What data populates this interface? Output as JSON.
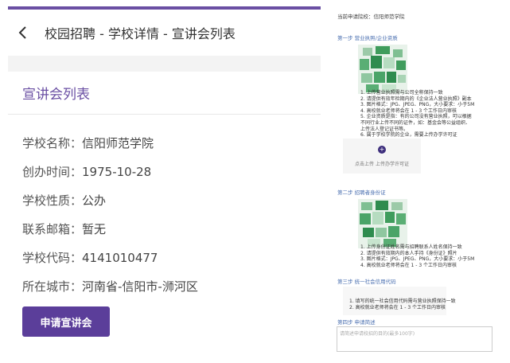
{
  "header": {
    "title": "校园招聘 - 学校详情 - 宣讲会列表"
  },
  "section": {
    "title": "宣讲会列表"
  },
  "school": {
    "fields": [
      {
        "label": "学校名称：",
        "value": "信阳师范学院"
      },
      {
        "label": "创办时间：",
        "value": "1975-10-28"
      },
      {
        "label": "学校性质：",
        "value": "公办"
      },
      {
        "label": "联系邮箱：",
        "value": "暂无"
      },
      {
        "label": "学校代码：",
        "value": "4141010477"
      },
      {
        "label": "所在城市：",
        "value": "河南省-信阳市-浉河区"
      }
    ],
    "apply_label": "申请宣讲会"
  },
  "form": {
    "target_label": "当前申请院校：",
    "target_value": "信阳师范学院",
    "step1": {
      "title": "第一步 营业执照/企业资质",
      "items": [
        "1. 上传营业执照需与公司全称保持一致",
        "2. 请提供有效年检期内的《企业法人营业执照》副本",
        "3. 图片格式：JPG、JPEG、PNG，大小要求：小于5M",
        "4. 高校就业老师将会在 1 - 3 个工作日内审核",
        "5. 企业资质是指：有的公司没有营业执照，可以根据",
        "   不同行业上传不同的证件，如：基金会等公益组织、",
        "   上传法人登记证书等。",
        "6. 属于学校学院的企业，需要上传办学许可证"
      ],
      "upload_text": "点击上传 上传办学许可证"
    },
    "step2": {
      "title": "第二步 招聘者身份证",
      "items": [
        "1. 上传身份证姓名需与招聘联系人姓名保持一致",
        "2. 请提供有效期内的本人手持《身份证》照片",
        "3. 图片格式：JPG、JPEG、PNG，大小要求：小于5M",
        "4. 高校就业老师将会在 1 - 3 个工作日内审核"
      ]
    },
    "step3": {
      "title": "第三步 统一社会信用代码",
      "items": [
        "1. 填写的统一社会信用代码需与营业执照保持一致",
        "2. 高校就业老师将会在 1 - 3 个工作日内审核"
      ]
    },
    "step4": {
      "title": "第四步 申请简述",
      "placeholder": "请简述申请校招的目的(最多100字)"
    }
  },
  "colors": {
    "accent": "#6a4fa3",
    "button": "#5b3e9a",
    "step_title": "#4a6fb0"
  }
}
